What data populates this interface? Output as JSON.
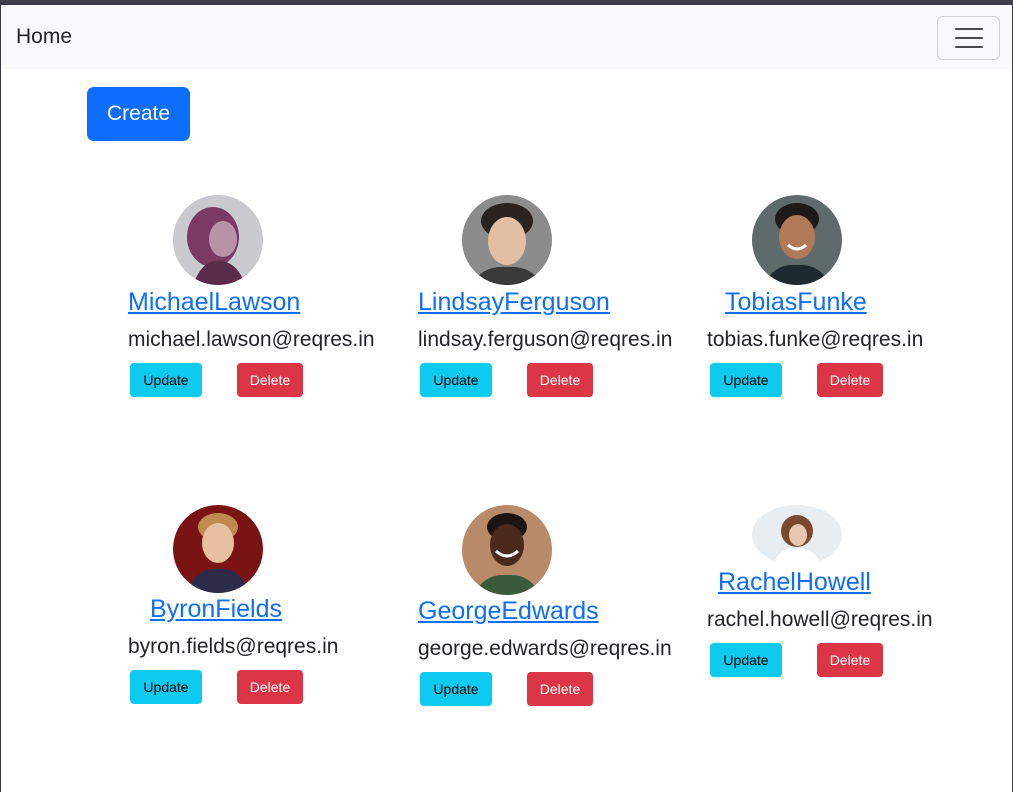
{
  "navbar": {
    "brand": "Home",
    "toggler_icon": "hamburger-icon"
  },
  "actions": {
    "create_label": "Create"
  },
  "users": [
    {
      "name": "MichaelLawson",
      "email": "michael.lawson@reqres.in",
      "update_label": "Update",
      "delete_label": "Delete",
      "avatar_icon": "user-avatar"
    },
    {
      "name": "LindsayFerguson",
      "email": "lindsay.ferguson@reqres.in",
      "update_label": "Update",
      "delete_label": "Delete",
      "avatar_icon": "user-avatar"
    },
    {
      "name": "TobiasFunke",
      "email": "tobias.funke@reqres.in",
      "update_label": "Update",
      "delete_label": "Delete",
      "avatar_icon": "user-avatar"
    },
    {
      "name": "ByronFields",
      "email": "byron.fields@reqres.in",
      "update_label": "Update",
      "delete_label": "Delete",
      "avatar_icon": "user-avatar"
    },
    {
      "name": "GeorgeEdwards",
      "email": "george.edwards@reqres.in",
      "update_label": "Update",
      "delete_label": "Delete",
      "avatar_icon": "user-avatar"
    },
    {
      "name": "RachelHowell",
      "email": "rachel.howell@reqres.in",
      "update_label": "Update",
      "delete_label": "Delete",
      "avatar_icon": "user-avatar"
    }
  ],
  "colors": {
    "primary": "#0d6efd",
    "info": "#0dcaf0",
    "danger": "#dc3545",
    "navbar_bg": "#f8f9fa"
  }
}
